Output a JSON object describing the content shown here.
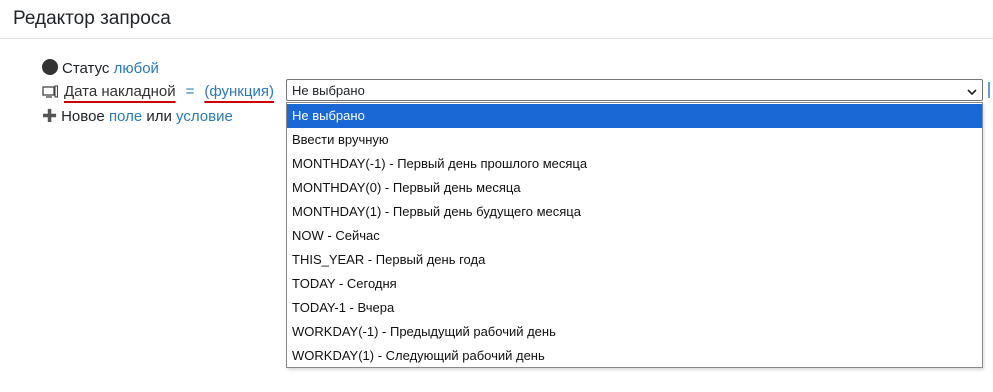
{
  "header": {
    "title": "Редактор запроса"
  },
  "status_row": {
    "label": "Статус",
    "value": "любой"
  },
  "condition_row": {
    "field": "Дата накладной",
    "operator": "=",
    "mode": "(функция)"
  },
  "new_row": {
    "prefix": "Новое",
    "field_link": "поле",
    "or_text": "или",
    "condition_link": "условие"
  },
  "select": {
    "value": "Не выбрано",
    "options": [
      "Не выбрано",
      "Ввести вручную",
      "MONTHDAY(-1) - Первый день прошлого месяца",
      "MONTHDAY(0) - Первый день месяца",
      "MONTHDAY(1) - Первый день будущего месяца",
      "NOW - Сейчас",
      "THIS_YEAR - Первый день года",
      "TODAY - Сегодня",
      "TODAY-1 - Вчера",
      "WORKDAY(-1) - Предыдущий рабочий день",
      "WORKDAY(1) - Следующий рабочий день"
    ],
    "selected_index": 0
  },
  "colors": {
    "link": "#2a7ab8",
    "selected_bg": "#1a68d6",
    "annotation_underline": "#cc0000"
  },
  "icons": {
    "status": "circle-icon",
    "field": "field-monitor-icon",
    "add": "plus-icon",
    "select_arrow": "chevron-down-icon"
  }
}
